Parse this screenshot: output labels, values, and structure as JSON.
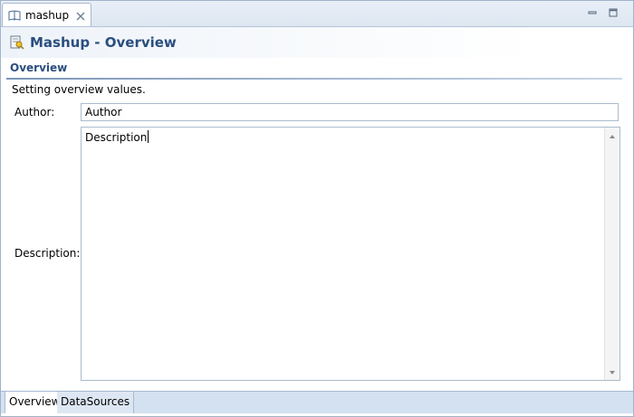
{
  "editor_tab": {
    "label": "mashup",
    "icon": "book-icon",
    "close_icon": "close-icon"
  },
  "window_controls": {
    "minimize_icon": "minimize-icon",
    "maximize_icon": "maximize-icon"
  },
  "form": {
    "title": "Mashup - Overview",
    "icon": "mashup-form-icon"
  },
  "section": {
    "title": "Overview",
    "description": "Setting overview values."
  },
  "fields": {
    "author_label": "Author:",
    "author_value": "Author",
    "description_label": "Description:",
    "description_value": "Description"
  },
  "page_tabs": [
    {
      "label": "Overview",
      "active": true
    },
    {
      "label": "DataSources",
      "active": false
    }
  ],
  "colors": {
    "title_blue": "#2a4e7e",
    "tab_strip": "#dde6f1",
    "page_tabs_bg": "#d4e1f0"
  }
}
